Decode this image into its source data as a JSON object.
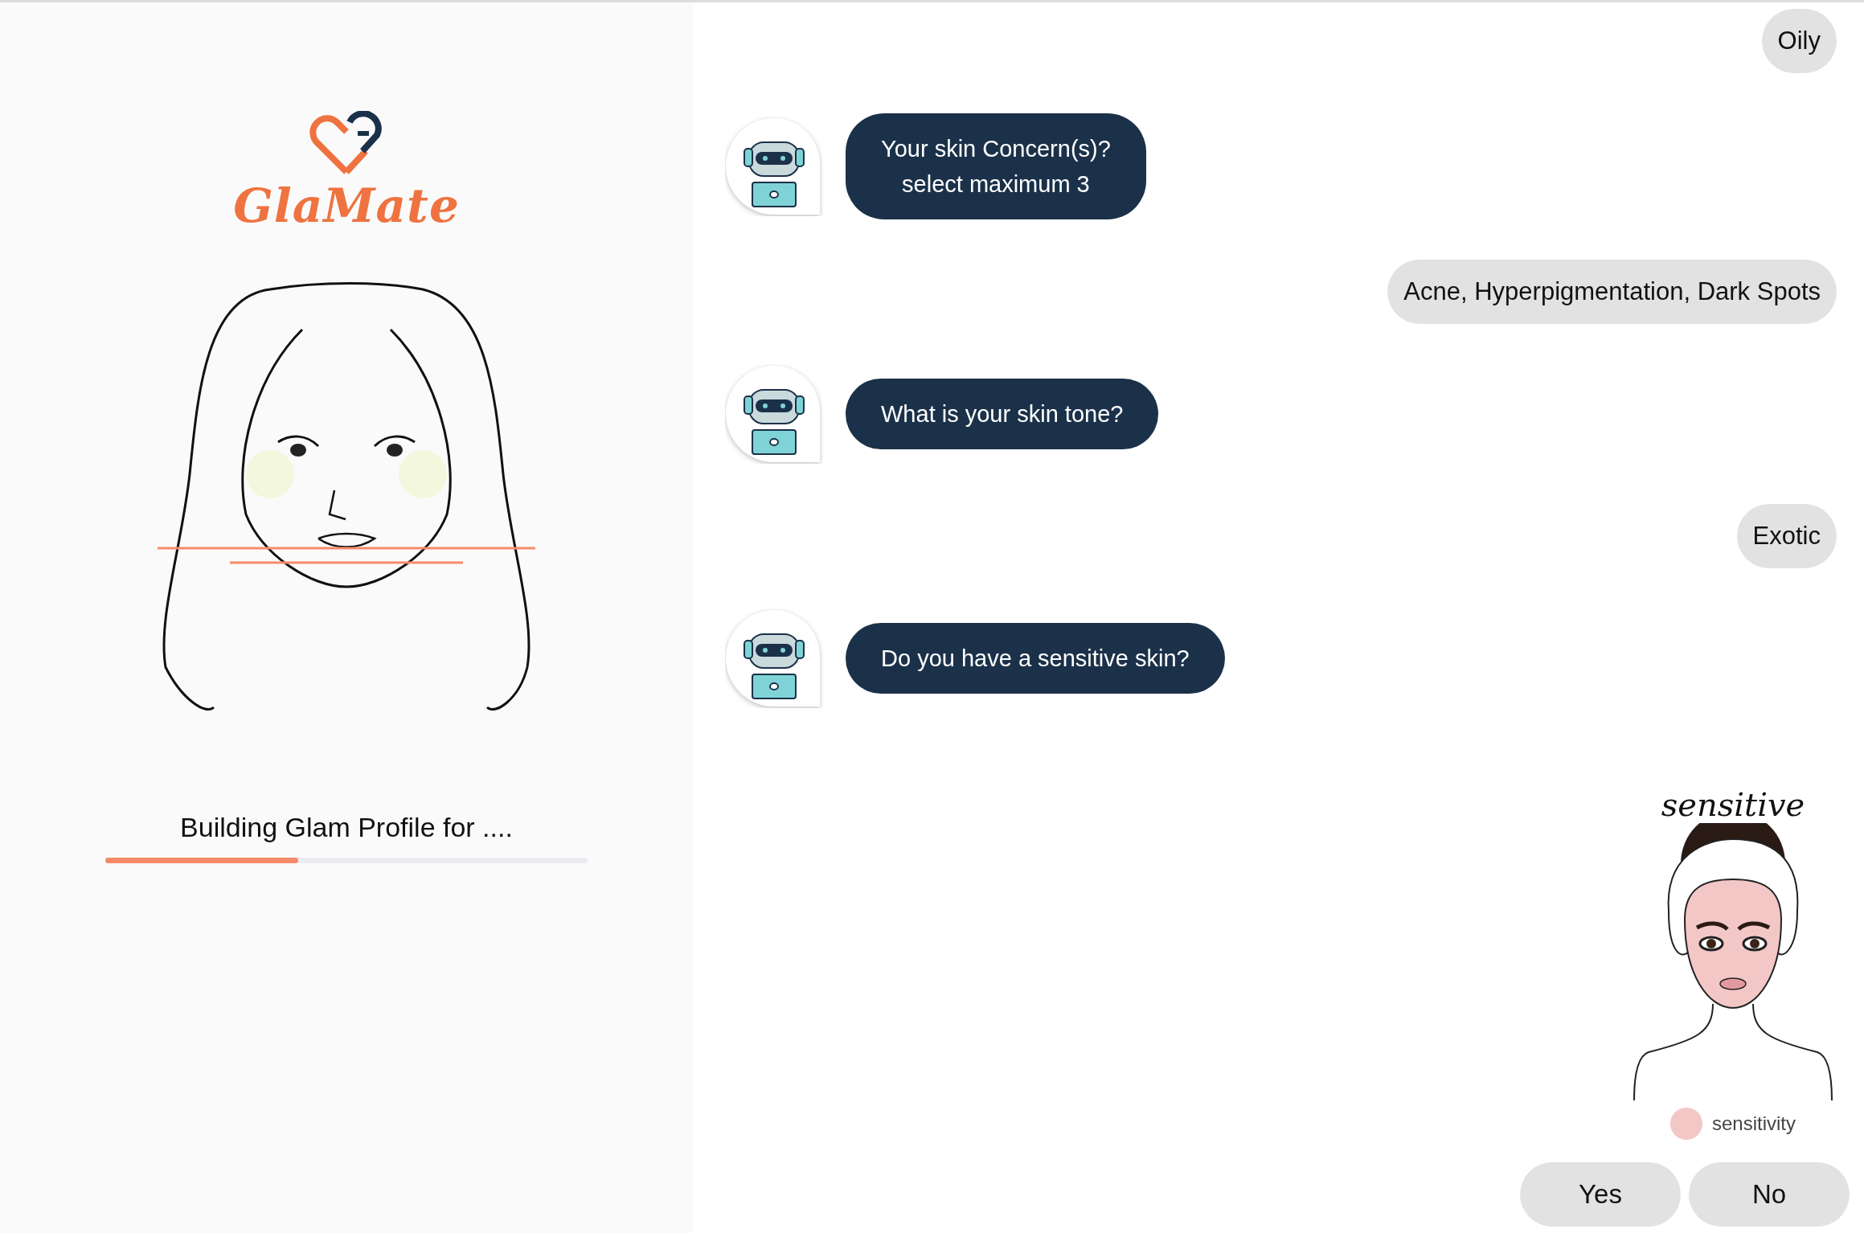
{
  "sidebar": {
    "logo_text": "GlaMate",
    "status": "Building Glam Profile for ....",
    "progress": {
      "level": 0.4
    }
  },
  "messages": [
    {
      "kind": "user",
      "text": "Oily"
    },
    {
      "kind": "bot",
      "lines": [
        "Your skin Concern(s)?",
        "select maximum 3"
      ]
    },
    {
      "kind": "user",
      "text": "Acne, Hyperpigmentation, Dark Spots"
    },
    {
      "kind": "bot",
      "lines": [
        "What is your skin tone?"
      ]
    },
    {
      "kind": "user",
      "text": "Exotic"
    },
    {
      "kind": "bot",
      "lines": [
        "Do you have a sensitive skin?"
      ]
    }
  ],
  "illustration": {
    "title": "sensitive",
    "legend": {
      "label": "sensitivity",
      "color": "#f4c7c7"
    }
  },
  "answers": [
    "Yes",
    "No"
  ]
}
